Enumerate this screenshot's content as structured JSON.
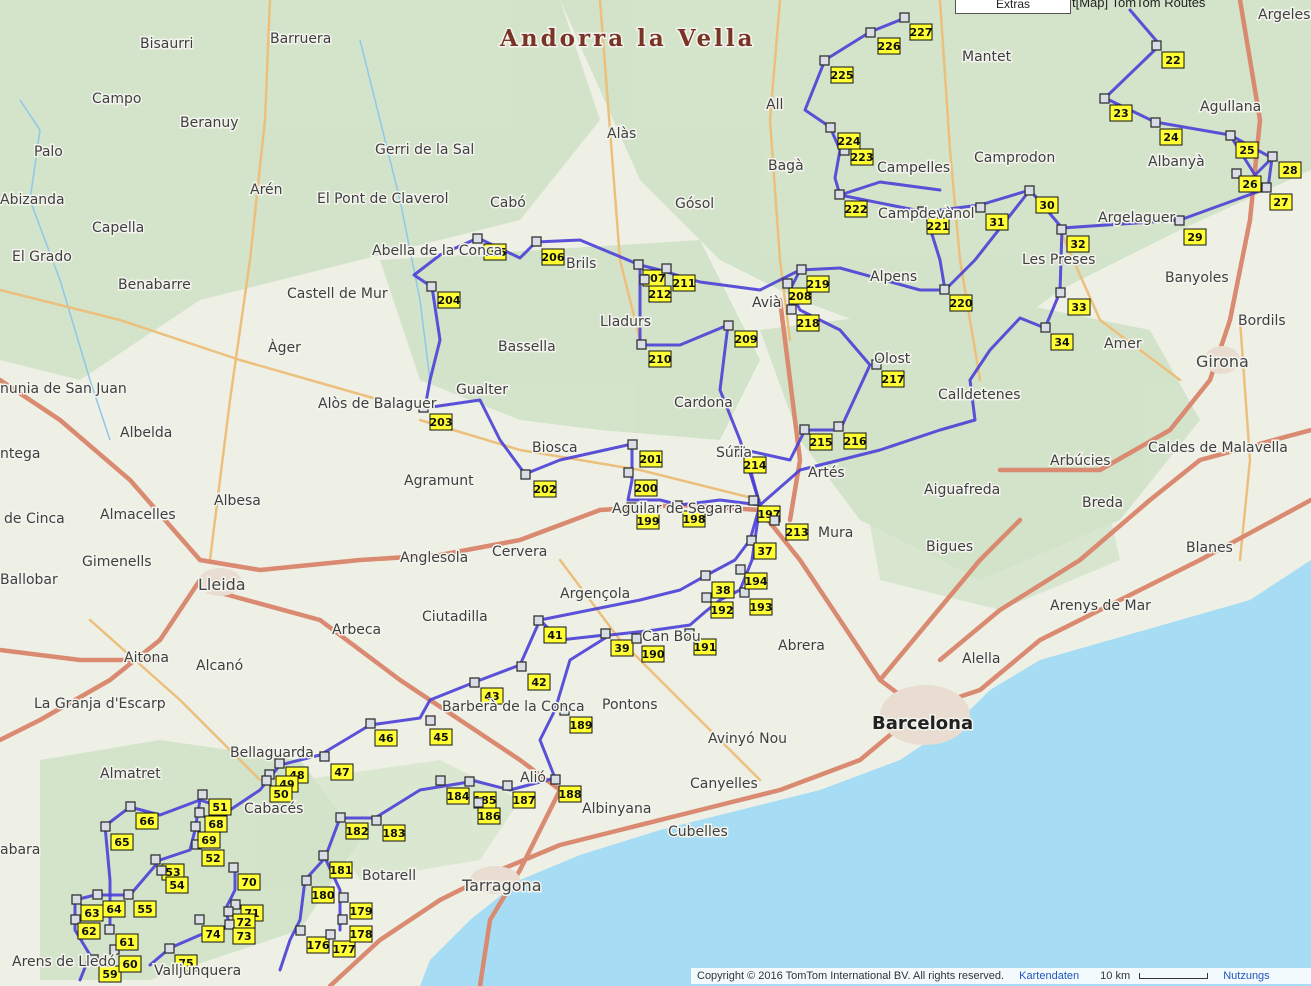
{
  "header": {
    "extras_button": "Extras",
    "title": "t[Map] TomTom Routes"
  },
  "attribution": {
    "copyright": "Copyright © 2016 TomTom International BV. All rights reserved.",
    "map_data_link": "Kartendaten",
    "scale_label": "10 km",
    "terms_link": "Nutzungs"
  },
  "colors": {
    "route": "#4a3fd6",
    "waypoint_label": "#ffff33",
    "sea": "#a6dcf4",
    "land": "#eef0e6",
    "forest": "#cfe2c6",
    "highway": "#d98a70"
  },
  "places": [
    {
      "name": "Andorra la Vella",
      "kind": "region"
    },
    {
      "name": "Barcelona",
      "kind": "big"
    },
    {
      "name": "Lleida",
      "kind": "mid"
    },
    {
      "name": "Tarragona",
      "kind": "mid"
    },
    {
      "name": "Girona",
      "kind": "mid"
    },
    {
      "name": "Bisaurri"
    },
    {
      "name": "Barruera"
    },
    {
      "name": "Campo"
    },
    {
      "name": "Beranuy"
    },
    {
      "name": "Palo"
    },
    {
      "name": "Gerri de la Sal"
    },
    {
      "name": "Alàs"
    },
    {
      "name": "All"
    },
    {
      "name": "Mantet"
    },
    {
      "name": "Argeles"
    },
    {
      "name": "Agullana"
    },
    {
      "name": "Albanyà"
    },
    {
      "name": "Camprodon"
    },
    {
      "name": "Campelles"
    },
    {
      "name": "Bagà"
    },
    {
      "name": "Cabó"
    },
    {
      "name": "El Pont de Claverol"
    },
    {
      "name": "Arén"
    },
    {
      "name": "Abizanda"
    },
    {
      "name": "Capella"
    },
    {
      "name": "El Grado"
    },
    {
      "name": "Gósol"
    },
    {
      "name": "Campdevànol"
    },
    {
      "name": "Argelaguer"
    },
    {
      "name": "Les Preses"
    },
    {
      "name": "Banyoles"
    },
    {
      "name": "Abella de la Conca"
    },
    {
      "name": "Brils"
    },
    {
      "name": "Alpens"
    },
    {
      "name": "Benabarre"
    },
    {
      "name": "Castell de Mur"
    },
    {
      "name": "Lladurs"
    },
    {
      "name": "Avià"
    },
    {
      "name": "Bordils"
    },
    {
      "name": "Àger"
    },
    {
      "name": "Bassella"
    },
    {
      "name": "Olost"
    },
    {
      "name": "Amer"
    },
    {
      "name": "nunia de San Juan"
    },
    {
      "name": "Gualter"
    },
    {
      "name": "Cardona"
    },
    {
      "name": "Calldetenes"
    },
    {
      "name": "Alòs de Balaguer"
    },
    {
      "name": "Albelda"
    },
    {
      "name": "Biosca"
    },
    {
      "name": "Súria"
    },
    {
      "name": "Artés"
    },
    {
      "name": "Arbúcies"
    },
    {
      "name": "Caldes de Malavella"
    },
    {
      "name": "ntega"
    },
    {
      "name": "Agramunt"
    },
    {
      "name": "Aiguafreda"
    },
    {
      "name": "Albesa"
    },
    {
      "name": "Breda"
    },
    {
      "name": "de Cinca"
    },
    {
      "name": "Almacelles"
    },
    {
      "name": "Aguilar de Segarra"
    },
    {
      "name": "Mura"
    },
    {
      "name": "Anglesola"
    },
    {
      "name": "Cervera"
    },
    {
      "name": "Bigues"
    },
    {
      "name": "Blanes"
    },
    {
      "name": "Gimenells"
    },
    {
      "name": "Ballobar"
    },
    {
      "name": "Argençola"
    },
    {
      "name": "Arenys de Mar"
    },
    {
      "name": "Ciutadilla"
    },
    {
      "name": "Arbeca"
    },
    {
      "name": "Aitona"
    },
    {
      "name": "Alcanó"
    },
    {
      "name": "Can Bou"
    },
    {
      "name": "Abrera"
    },
    {
      "name": "Alella"
    },
    {
      "name": "La Granja d'Escarp"
    },
    {
      "name": "Barberà de la Conca"
    },
    {
      "name": "Pontons"
    },
    {
      "name": "Avinyó Nou"
    },
    {
      "name": "Bellaguarda"
    },
    {
      "name": "Almatret"
    },
    {
      "name": "Alió"
    },
    {
      "name": "Canyelles"
    },
    {
      "name": "Cabacés"
    },
    {
      "name": "Albinyana"
    },
    {
      "name": "Cubelles"
    },
    {
      "name": "abara"
    },
    {
      "name": "Botarell"
    },
    {
      "name": "Arens de Lledó"
    },
    {
      "name": "Valljunquera"
    }
  ],
  "waypoints": [
    "22",
    "23",
    "24",
    "25",
    "26",
    "27",
    "28",
    "29",
    "30",
    "31",
    "32",
    "33",
    "34",
    "37",
    "38",
    "39",
    "41",
    "42",
    "43",
    "45",
    "46",
    "47",
    "48",
    "49",
    "50",
    "51",
    "52",
    "53",
    "54",
    "55",
    "59",
    "60",
    "61",
    "62",
    "63",
    "64",
    "65",
    "66",
    "68",
    "69",
    "70",
    "71",
    "72",
    "73",
    "74",
    "75",
    "176",
    "177",
    "178",
    "179",
    "180",
    "181",
    "182",
    "183",
    "184",
    "185",
    "186",
    "187",
    "188",
    "189",
    "190",
    "191",
    "192",
    "193",
    "194",
    "197",
    "198",
    "199",
    "200",
    "201",
    "202",
    "203",
    "204",
    "205",
    "206",
    "207",
    "208",
    "209",
    "210",
    "211",
    "212",
    "213",
    "214",
    "215",
    "216",
    "217",
    "218",
    "219",
    "220",
    "221",
    "222",
    "223",
    "224",
    "225",
    "226",
    "227"
  ]
}
